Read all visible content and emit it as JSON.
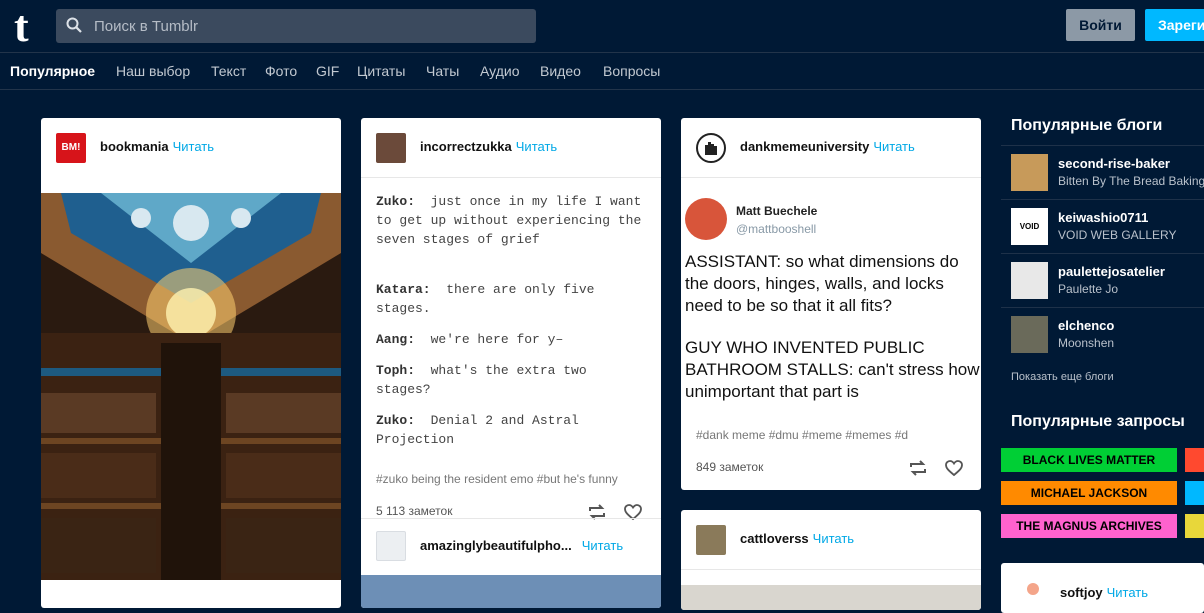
{
  "header": {
    "logo": "t",
    "search_placeholder": "Поиск в Tumblr",
    "login_label": "Войти",
    "register_label": "Зарегистрироваться"
  },
  "tabs": [
    "Популярное",
    "Наш выбор",
    "Текст",
    "Фото",
    "GIF",
    "Цитаты",
    "Чаты",
    "Аудио",
    "Видео",
    "Вопросы"
  ],
  "posts": {
    "p1": {
      "name": "bookmania",
      "follow": "Читать",
      "avatar_text": "BM!"
    },
    "p2": {
      "name": "incorrectzukka",
      "follow": "Читать",
      "lines": [
        {
          "speaker": "Zuko:",
          "text": "just once in my life I want to get up without experiencing the seven stages of grief"
        },
        {
          "speaker": "Katara:",
          "text": "there are only five stages."
        },
        {
          "speaker": "Aang:",
          "text": "we're here for y–"
        },
        {
          "speaker": "Toph:",
          "text": "what's the extra two stages?"
        },
        {
          "speaker": "Zuko:",
          "text": "Denial 2 and Astral Projection"
        }
      ],
      "tags": "#zuko being the resident emo    #but he's funny",
      "notes": "5 113 заметок"
    },
    "p2b": {
      "name": "amazinglybeautifulpho...",
      "follow": "Читать"
    },
    "p3": {
      "name": "dankmemeuniversity",
      "follow": "Читать",
      "tweet_author": "Matt Buechele",
      "tweet_handle": "@mattbooshell",
      "tweet_p1": "ASSISTANT: so what dimensions do the doors, hinges, walls, and locks need to be so that it all fits?",
      "tweet_p2": "GUY WHO INVENTED PUBLIC BATHROOM STALLS: can't stress how unimportant that part is",
      "tags": "#dank meme    #dmu    #meme    #memes    #d",
      "notes": "849 заметок"
    },
    "p4": {
      "name": "cattloverss",
      "follow": "Читать"
    }
  },
  "sidebar": {
    "blogs_title": "Популярные блоги",
    "blogs": [
      {
        "name": "second-rise-baker",
        "sub": "Bitten By The Bread Baking Bug"
      },
      {
        "name": "keiwashio0711",
        "sub": "VOID WEB GALLERY",
        "avatar_text": "VOID"
      },
      {
        "name": "paulettejosatelier",
        "sub": "Paulette Jo"
      },
      {
        "name": "elchenco",
        "sub": "Moonshen"
      }
    ],
    "more_blogs": "Показать еще блоги",
    "queries_title": "Популярные запросы",
    "queries": [
      {
        "label": "BLACK LIVES MATTER",
        "color": "#00cf35"
      },
      {
        "label": "MICHAEL JACKSON",
        "color": "#ff8a00"
      },
      {
        "label": "THE MAGNUS ARCHIVES",
        "color": "#ff62ce"
      }
    ],
    "softjoy": {
      "name": "softjoy",
      "follow": "Читать"
    }
  },
  "colors": {
    "bg": "#001935",
    "accent": "#00b8ff",
    "link": "#00a8e6"
  }
}
